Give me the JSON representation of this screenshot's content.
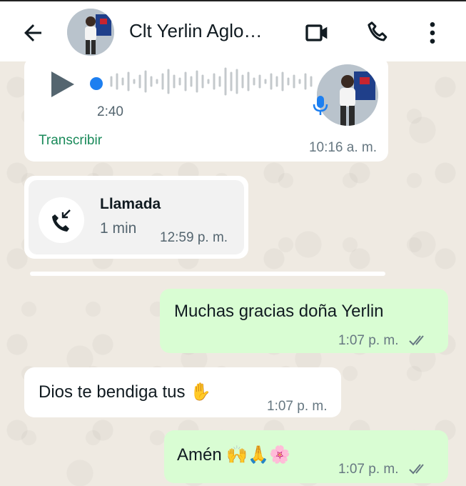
{
  "header": {
    "contact_name": "Clt Yerlin Aglo…"
  },
  "voice_message": {
    "duration": "2:40",
    "transcribe_label": "Transcribir",
    "time": "10:16 a. m."
  },
  "call_message": {
    "title": "Llamada",
    "duration": "1 min",
    "time": "12:59 p. m."
  },
  "messages": [
    {
      "direction": "out",
      "text": "Muchas gracias doña Yerlin",
      "time": "1:07 p. m.",
      "status": "read"
    },
    {
      "direction": "in",
      "text": "Dios te bendiga tus ✋",
      "time": "1:07 p. m."
    },
    {
      "direction": "out",
      "text": "Amén 🙌🙏🌸",
      "time": "1:07 p. m.",
      "status": "read"
    }
  ],
  "colors": {
    "header_bg": "#ffffff",
    "chat_bg": "#efeae2",
    "incoming_bubble": "#ffffff",
    "outgoing_bubble": "#d9fdd3",
    "accent_blue": "#1d7ff0",
    "transcribe_green": "#1a8a5a"
  }
}
